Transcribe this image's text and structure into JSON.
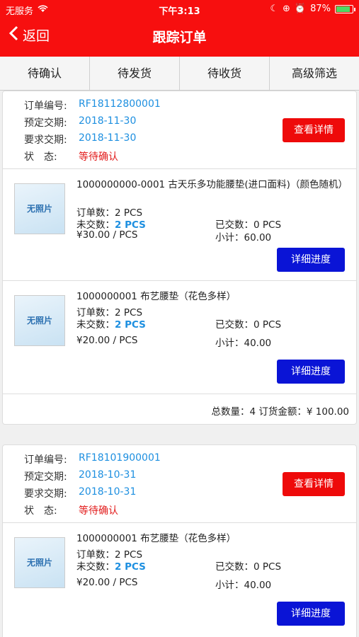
{
  "status_bar": {
    "carrier": "无服务",
    "time": "下午3:13",
    "battery": "87%",
    "battery_level": 0.87
  },
  "nav": {
    "back_label": "返回",
    "title": "跟踪订单"
  },
  "tabs": [
    {
      "label": "待确认"
    },
    {
      "label": "待发货"
    },
    {
      "label": "待收货"
    },
    {
      "label": "高级筛选"
    }
  ],
  "labels": {
    "order_no": "订单编号:",
    "planned": "预定交期:",
    "required": "要求交期:",
    "status": "状　态:",
    "view_detail": "查看详情",
    "progress": "详细进度",
    "no_photo": "无照片"
  },
  "orders": [
    {
      "order_no": "RF18112800001",
      "planned": "2018-11-30",
      "required": "2018-11-30",
      "status": "等待确认",
      "items": [
        {
          "title": "1000000000-0001 古天乐多功能腰垫(进口面料)（颜色随机）",
          "ordered": "订单数：2 PCS",
          "undelivered_label": "未交数：",
          "undelivered": "2 PCS",
          "delivered": "已交数：0 PCS",
          "price": "¥30.00 / PCS",
          "subtotal": "小计：60.00"
        },
        {
          "title": "1000000001 布艺腰垫（花色多样）",
          "ordered": "订单数：2 PCS",
          "undelivered_label": "未交数：",
          "undelivered": "2 PCS",
          "delivered": "已交数：0 PCS",
          "price": "¥20.00 / PCS",
          "subtotal": "小计：40.00"
        }
      ],
      "summary": "总数量：4  订货金额：¥ 100.00"
    },
    {
      "order_no": "RF18101900001",
      "planned": "2018-10-31",
      "required": "2018-10-31",
      "status": "等待确认",
      "items": [
        {
          "title": "1000000001 布艺腰垫（花色多样）",
          "ordered": "订单数：2 PCS",
          "undelivered_label": "未交数：",
          "undelivered": "2 PCS",
          "delivered": "已交数：0 PCS",
          "price": "¥20.00 / PCS",
          "subtotal": "小计：40.00"
        }
      ]
    }
  ]
}
